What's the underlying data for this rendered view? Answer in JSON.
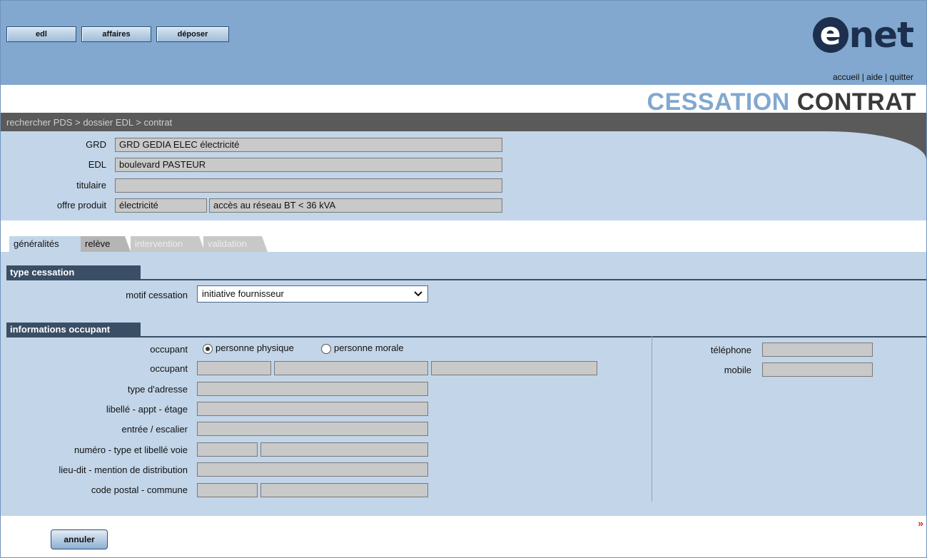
{
  "nav": {
    "edl": "edl",
    "affaires": "affaires",
    "deposer": "déposer"
  },
  "logo": {
    "e": "e",
    "net": "net"
  },
  "toplinks": {
    "accueil": "accueil",
    "sep1": " | ",
    "aide": "aide",
    "sep2": " | ",
    "quitter": "quitter"
  },
  "title": {
    "part1": "CESSATION",
    "part2": "CONTRAT"
  },
  "breadcrumb": {
    "c1": "rechercher PDS",
    "sep1": " > ",
    "c2": "dossier EDL",
    "sep2": " > ",
    "c3": "contrat"
  },
  "info": {
    "grd_label": "GRD",
    "grd_value": "GRD GEDIA ELEC électricité",
    "edl_label": "EDL",
    "edl_value": "boulevard PASTEUR",
    "titulaire_label": "titulaire",
    "titulaire_value": "",
    "offre_label": "offre produit",
    "offre_value1": "électricité",
    "offre_value2": "accès au réseau BT < 36 kVA"
  },
  "tabs": [
    {
      "label": "généralités",
      "state": "active"
    },
    {
      "label": "relève",
      "state": "normal"
    },
    {
      "label": "intervention",
      "state": "disabled"
    },
    {
      "label": "validation",
      "state": "disabled"
    }
  ],
  "type_cessation": {
    "heading": "type cessation",
    "motif_label": "motif cessation",
    "motif_value": "initiative fournisseur"
  },
  "occupant": {
    "heading": "informations occupant",
    "occupant_label": "occupant",
    "radio1": "personne physique",
    "radio2": "personne morale",
    "occupant2_label": "occupant",
    "type_adresse_label": "type d'adresse",
    "libelle_label": "libellé - appt - étage",
    "entree_label": "entrée / escalier",
    "numero_label": "numéro - type et libellé voie",
    "lieudit_label": "lieu-dit - mention de distribution",
    "cp_label": "code postal - commune",
    "telephone_label": "téléphone",
    "mobile_label": "mobile"
  },
  "footer": {
    "annuler": "annuler",
    "next": "»"
  },
  "colors": {
    "header_blue": "#82a8cf",
    "panel_blue": "#c3d5e8",
    "section_dark": "#3a4e66",
    "grey_bar": "#5a5a5a",
    "field_grey": "#c9c9c9"
  }
}
